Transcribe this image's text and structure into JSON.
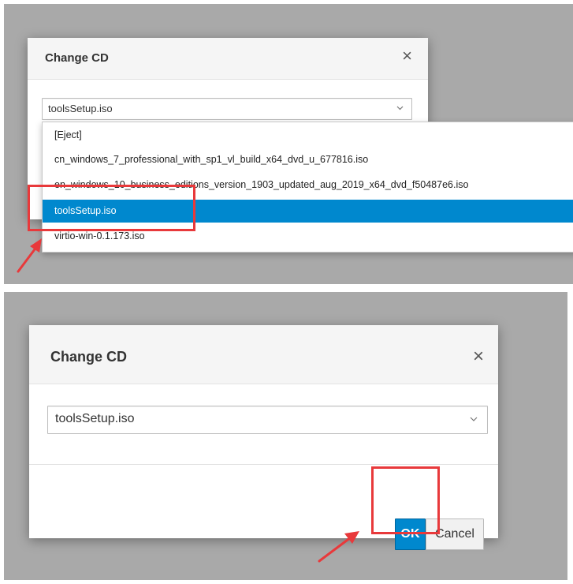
{
  "top_panel": {
    "dialog": {
      "title": "Change CD",
      "close_symbol": "×",
      "select": {
        "value": "toolsSetup.iso",
        "icon": "chevron-down-icon"
      }
    },
    "dropdown": {
      "options": [
        "[Eject]",
        "cn_windows_7_professional_with_sp1_vl_build_x64_dvd_u_677816.iso",
        "en_windows_10_business_editions_version_1903_updated_aug_2019_x64_dvd_f50487e6.iso",
        "toolsSetup.iso",
        "virtio-win-0.1.173.iso"
      ],
      "selected": "toolsSetup.iso"
    }
  },
  "bottom_panel": {
    "dialog": {
      "title": "Change CD",
      "close_symbol": "×",
      "select": {
        "value": "toolsSetup.iso",
        "icon": "chevron-down-icon"
      },
      "buttons": {
        "ok": "OK",
        "cancel": "Cancel"
      }
    }
  },
  "colors": {
    "backdrop": "#a9a9a9",
    "primary": "#0088ce",
    "annotation": "#e8393b"
  }
}
